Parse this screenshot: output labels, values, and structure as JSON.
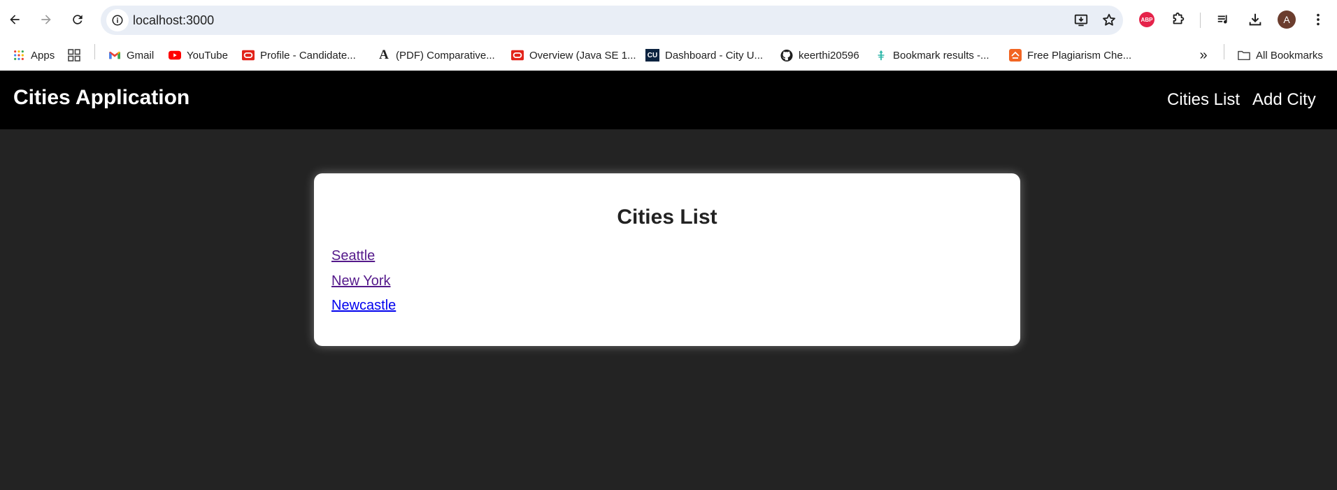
{
  "browser": {
    "url": "localhost:3000",
    "bookmarks": [
      {
        "label": "Apps",
        "icon": "apps-grid-icon"
      },
      {
        "label": "",
        "icon": "tab-groups-icon"
      },
      {
        "label": "Gmail",
        "icon": "gmail-icon"
      },
      {
        "label": "YouTube",
        "icon": "youtube-icon"
      },
      {
        "label": "Profile - Candidate...",
        "icon": "oracle-icon"
      },
      {
        "label": "(PDF) Comparative...",
        "icon": "academia-icon"
      },
      {
        "label": "Overview (Java SE 1...",
        "icon": "oracle-icon"
      },
      {
        "label": "Dashboard - City U...",
        "icon": "cu-icon"
      },
      {
        "label": "keerthi20596",
        "icon": "github-icon"
      },
      {
        "label": "Bookmark results -...",
        "icon": "bookmark-results-icon"
      },
      {
        "label": "Free Plagiarism Che...",
        "icon": "plagiarism-icon"
      }
    ],
    "all_bookmarks_label": "All Bookmarks",
    "abp_label": "ABP",
    "avatar_letter": "A"
  },
  "app": {
    "title": "Cities Application",
    "nav": {
      "cities_list": "Cities List",
      "add_city": "Add City"
    },
    "card": {
      "title": "Cities List",
      "cities": [
        "Seattle",
        "New York",
        "Newcastle"
      ]
    }
  },
  "colors": {
    "navbar_bg": "#000000",
    "page_bg": "#232323",
    "visited_link": "#551a8b",
    "unvisited_link": "#0000ee"
  }
}
